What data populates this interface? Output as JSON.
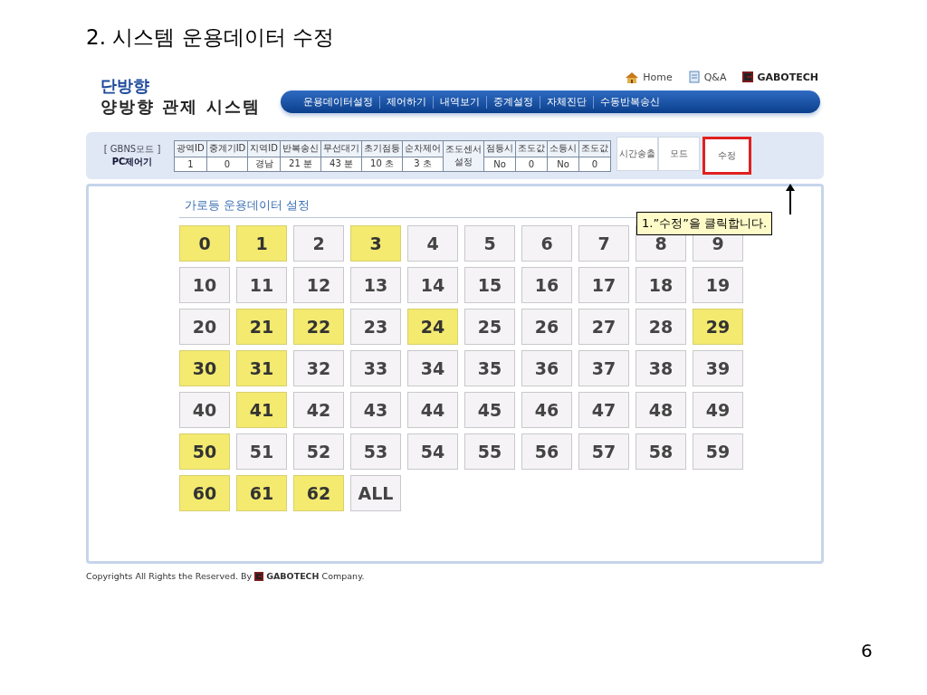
{
  "slide": {
    "title": "2. 시스템 운용데이터 수정",
    "page_number": "6"
  },
  "header": {
    "logo_lines": [
      "단방향",
      "양방향 관제 시스템"
    ],
    "links": [
      {
        "kind": "home",
        "label": "Home"
      },
      {
        "kind": "qa",
        "label": "Q&A"
      },
      {
        "kind": "brand",
        "label": "GABOTECH"
      }
    ],
    "nav": [
      "운용데이터설정",
      "제어하기",
      "내역보기",
      "중계설정",
      "자체진단",
      "수동반복송신"
    ]
  },
  "info": {
    "mode_label": "[ GBNS모드 ]",
    "mode_value": "PC제어기",
    "columns": [
      {
        "kind": "pair",
        "header": "광역ID",
        "value": "1"
      },
      {
        "kind": "pair",
        "header": "중계기ID",
        "value": "0"
      },
      {
        "kind": "pair",
        "header": "지역ID",
        "value": "경남"
      },
      {
        "kind": "pair",
        "header": "반복송신",
        "value": "21 분"
      },
      {
        "kind": "pair",
        "header": "무선대기",
        "value": "43 분"
      },
      {
        "kind": "pair",
        "header": "초기점등",
        "value": "10 초"
      },
      {
        "kind": "pair",
        "header": "순차제어",
        "value": "3 초"
      },
      {
        "kind": "merged",
        "header": "조도센서",
        "value": "설정"
      },
      {
        "kind": "pair",
        "header": "점등시",
        "value": "No"
      },
      {
        "kind": "pair",
        "header": "조도값",
        "value": "0"
      },
      {
        "kind": "pair",
        "header": "소등시",
        "value": "No"
      },
      {
        "kind": "pair",
        "header": "조도값",
        "value": "0"
      }
    ],
    "buttons": [
      {
        "label": "시간송출",
        "highlighted": false
      },
      {
        "label": "모드",
        "highlighted": false
      },
      {
        "label": "수정",
        "highlighted": true
      }
    ]
  },
  "panel": {
    "title": "가로등 운용데이터 설정",
    "tiles": [
      {
        "label": "0",
        "selected": true
      },
      {
        "label": "1",
        "selected": true
      },
      {
        "label": "2",
        "selected": false
      },
      {
        "label": "3",
        "selected": true
      },
      {
        "label": "4",
        "selected": false
      },
      {
        "label": "5",
        "selected": false
      },
      {
        "label": "6",
        "selected": false
      },
      {
        "label": "7",
        "selected": false
      },
      {
        "label": "8",
        "selected": false
      },
      {
        "label": "9",
        "selected": false
      },
      {
        "label": "10",
        "selected": false
      },
      {
        "label": "11",
        "selected": false
      },
      {
        "label": "12",
        "selected": false
      },
      {
        "label": "13",
        "selected": false
      },
      {
        "label": "14",
        "selected": false
      },
      {
        "label": "15",
        "selected": false
      },
      {
        "label": "16",
        "selected": false
      },
      {
        "label": "17",
        "selected": false
      },
      {
        "label": "18",
        "selected": false
      },
      {
        "label": "19",
        "selected": false
      },
      {
        "label": "20",
        "selected": false
      },
      {
        "label": "21",
        "selected": true
      },
      {
        "label": "22",
        "selected": true
      },
      {
        "label": "23",
        "selected": false
      },
      {
        "label": "24",
        "selected": true
      },
      {
        "label": "25",
        "selected": false
      },
      {
        "label": "26",
        "selected": false
      },
      {
        "label": "27",
        "selected": false
      },
      {
        "label": "28",
        "selected": false
      },
      {
        "label": "29",
        "selected": true
      },
      {
        "label": "30",
        "selected": true
      },
      {
        "label": "31",
        "selected": true
      },
      {
        "label": "32",
        "selected": false
      },
      {
        "label": "33",
        "selected": false
      },
      {
        "label": "34",
        "selected": false
      },
      {
        "label": "35",
        "selected": false
      },
      {
        "label": "36",
        "selected": false
      },
      {
        "label": "37",
        "selected": false
      },
      {
        "label": "38",
        "selected": false
      },
      {
        "label": "39",
        "selected": false
      },
      {
        "label": "40",
        "selected": false
      },
      {
        "label": "41",
        "selected": true
      },
      {
        "label": "42",
        "selected": false
      },
      {
        "label": "43",
        "selected": false
      },
      {
        "label": "44",
        "selected": false
      },
      {
        "label": "45",
        "selected": false
      },
      {
        "label": "46",
        "selected": false
      },
      {
        "label": "47",
        "selected": false
      },
      {
        "label": "48",
        "selected": false
      },
      {
        "label": "49",
        "selected": false
      },
      {
        "label": "50",
        "selected": true
      },
      {
        "label": "51",
        "selected": false
      },
      {
        "label": "52",
        "selected": false
      },
      {
        "label": "53",
        "selected": false
      },
      {
        "label": "54",
        "selected": false
      },
      {
        "label": "55",
        "selected": false
      },
      {
        "label": "56",
        "selected": false
      },
      {
        "label": "57",
        "selected": false
      },
      {
        "label": "58",
        "selected": false
      },
      {
        "label": "59",
        "selected": false
      },
      {
        "label": "60",
        "selected": true
      },
      {
        "label": "61",
        "selected": true
      },
      {
        "label": "62",
        "selected": true
      },
      {
        "label": "ALL",
        "selected": false
      }
    ]
  },
  "callout": "1.”수정”을 클릭합니다.",
  "footer": {
    "text": "Copyrights All Rights the Reserved. By",
    "brand": "**GABOTECH** Company."
  }
}
